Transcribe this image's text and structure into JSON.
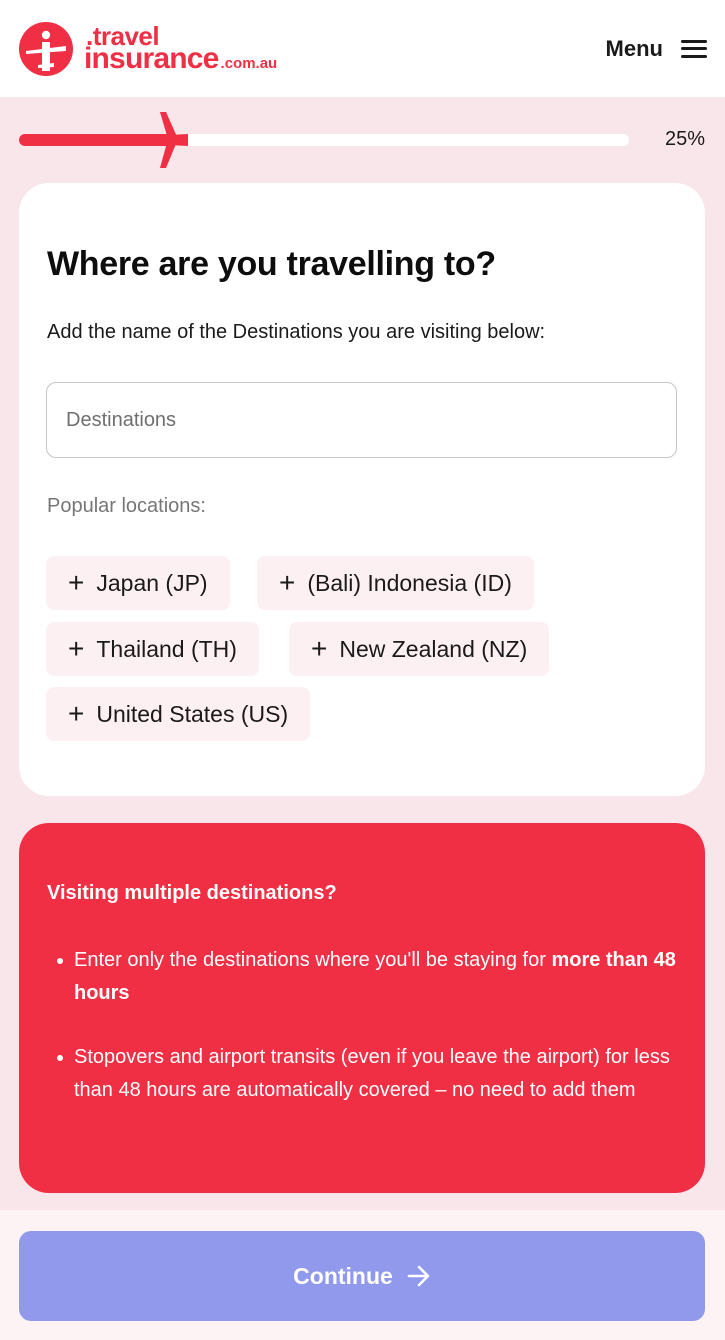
{
  "header": {
    "logo": {
      "line1": ".travel",
      "line2": "insurance",
      "suffix": ".com.au"
    },
    "menu_label": "Menu",
    "brand_color": "#f02e44"
  },
  "progress": {
    "label": "25%",
    "fraction": 0.25
  },
  "card": {
    "title": "Where are you travelling to?",
    "subtitle": "Add the name of the Destinations you are visiting below:",
    "input_placeholder": "Destinations",
    "input_value": "",
    "popular_label": "Popular locations:",
    "chips": [
      {
        "label": "Japan (JP)"
      },
      {
        "label": "(Bali) Indonesia (ID)"
      },
      {
        "label": "Thailand (TH)"
      },
      {
        "label": "New Zealand (NZ)"
      },
      {
        "label": "United States (US)"
      }
    ]
  },
  "info": {
    "title": "Visiting multiple destinations?",
    "item1_text": "Enter only the destinations where you'll be staying for",
    "item1_bold": "more than 48 hours",
    "item2_text": "Stopovers and airport transits (even if you leave the airport) for less than 48 hours are automatically covered – no need to add them"
  },
  "footer": {
    "continue_label": "Continue",
    "button_color": "#9199ec"
  },
  "icons": {
    "logo": "plane-logo-icon",
    "menu": "hamburger-icon",
    "progress_marker": "plane-icon",
    "chip_add": "plus-icon",
    "continue": "arrow-right-icon"
  }
}
